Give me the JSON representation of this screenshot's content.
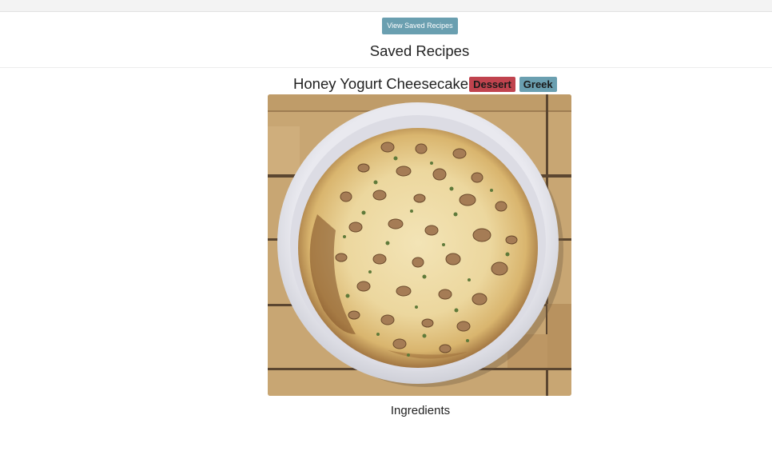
{
  "header": {
    "view_saved_label": "View Saved Recipes"
  },
  "page": {
    "title": "Saved Recipes"
  },
  "recipes": [
    {
      "title": "Honey Yogurt Cheesecake",
      "tags": [
        {
          "label": "Dessert",
          "color": "#c0434e"
        },
        {
          "label": "Greek",
          "color": "#6a9fb0"
        }
      ],
      "sections": {
        "ingredients_heading": "Ingredients"
      }
    }
  ],
  "colors": {
    "button": "#6a9fb0",
    "dessert_tag": "#c0434e",
    "greek_tag": "#6a9fb0"
  }
}
